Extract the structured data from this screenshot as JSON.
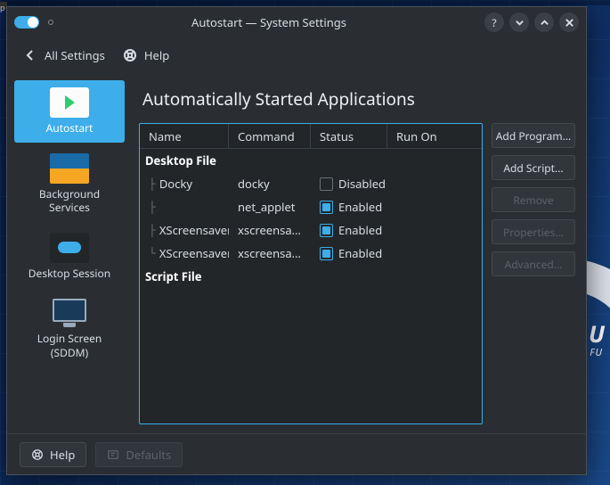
{
  "window": {
    "title": "Autostart — System Settings"
  },
  "toolbar": {
    "all_settings": "All Settings",
    "help": "Help"
  },
  "sidebar": {
    "items": [
      {
        "label": "Autostart"
      },
      {
        "label": "Background Services"
      },
      {
        "label": "Desktop Session"
      },
      {
        "label": "Login Screen (SDDM)"
      }
    ]
  },
  "main": {
    "title": "Automatically Started Applications",
    "columns": {
      "name": "Name",
      "command": "Command",
      "status": "Status",
      "run_on": "Run On"
    },
    "groups": {
      "desktop_file": "Desktop File",
      "script_file": "Script File"
    },
    "status_labels": {
      "enabled": "Enabled",
      "disabled": "Disabled"
    },
    "entries": [
      {
        "name": "Docky",
        "command": "docky",
        "enabled": false
      },
      {
        "name": "",
        "command": "net_applet",
        "enabled": true
      },
      {
        "name": "XScreensaver",
        "command": "xscreensaver ...",
        "enabled": true
      },
      {
        "name": "XScreensaver",
        "command": "xscreensaver",
        "enabled": true
      }
    ],
    "buttons": {
      "add_program": "Add Program...",
      "add_script": "Add Script...",
      "remove": "Remove",
      "properties": "Properties...",
      "advanced": "Advanced..."
    }
  },
  "footer": {
    "help": "Help",
    "defaults": "Defaults"
  }
}
